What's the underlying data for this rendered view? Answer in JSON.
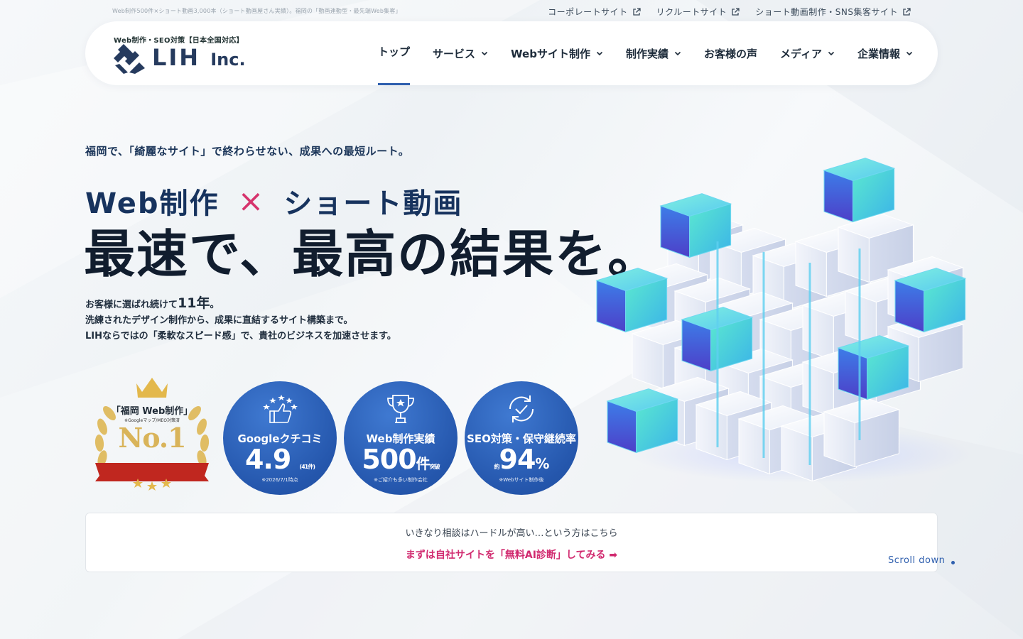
{
  "topbar": {
    "tagline": "Web制作500件×ショート動画3,000本（ショート動画屋さん実績）。福岡の「動画連動型・最先端Web集客」",
    "links": [
      {
        "label": "コーポレートサイト"
      },
      {
        "label": "リクルートサイト"
      },
      {
        "label": "ショート動画制作・SNS集客サイト"
      }
    ]
  },
  "header": {
    "logo_sub": "Web制作・SEO対策【日本全国対応】",
    "logo_name": "LIH",
    "logo_suffix": "Inc.",
    "nav": [
      {
        "label": "トップ",
        "active": true
      },
      {
        "label": "サービス",
        "dropdown": true
      },
      {
        "label": "Webサイト制作",
        "dropdown": true
      },
      {
        "label": "制作実績",
        "dropdown": true
      },
      {
        "label": "お客様の声"
      },
      {
        "label": "メディア",
        "dropdown": true
      },
      {
        "label": "企業情報",
        "dropdown": true
      }
    ]
  },
  "hero": {
    "lead": "福岡で、「綺麗なサイト」で終わらせない、成果への最短ルート。",
    "sub_left": "Web制作",
    "sub_cross": "×",
    "sub_right": "ショート動画",
    "main": "最速で、最高の結果を。",
    "desc_1_pre": "お客様に選ばれ続けて",
    "desc_1_big": "11年",
    "desc_1_post": "。",
    "desc_2": "洗練されたデザイン制作から、成果に直結するサイト構築まで。",
    "desc_3": "LIHならではの「柔軟なスピード感」で、貴社のビジネスを加速させます。"
  },
  "badges": {
    "award": {
      "title": "「福岡 Web制作」",
      "note": "※Googleマップ/MEO対策済",
      "rank": "No.1"
    },
    "stats": [
      {
        "icon": "thumbs-up-stars-icon",
        "label": "Googleクチコミ",
        "value": "4.9",
        "unit": "",
        "small": "(41件)",
        "note": "※2026/7/1時点"
      },
      {
        "icon": "trophy-icon",
        "label": "Web制作実績",
        "value": "500",
        "unit": "件",
        "small": "突破",
        "note": "※ご紹介も多い制作会社"
      },
      {
        "icon": "refresh-check-icon",
        "label": "SEO対策・保守継続率",
        "prefix": "約",
        "value": "94",
        "unit": "%",
        "note": "※Webサイト制作後"
      }
    ]
  },
  "cta": {
    "question": "いきなり相談はハードルが高い…という方はこちら",
    "link": "まずは自社サイトを「無料AI診断」してみる ➡"
  },
  "scroll_label": "Scroll down",
  "colors": {
    "accent_blue": "#2557ad",
    "accent_pink": "#d12a6f",
    "navy": "#17335e"
  }
}
